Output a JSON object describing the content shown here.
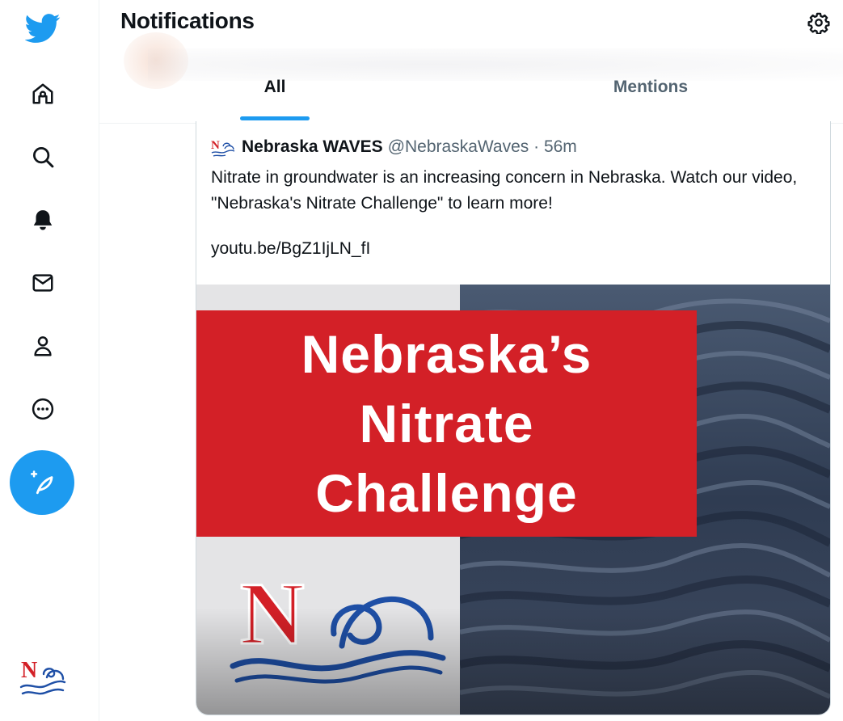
{
  "app": {
    "name": "Twitter"
  },
  "sidebar": {
    "items": [
      {
        "name": "home",
        "icon": "home-icon"
      },
      {
        "name": "explore",
        "icon": "search-icon"
      },
      {
        "name": "notifications",
        "icon": "bell-icon"
      },
      {
        "name": "messages",
        "icon": "mail-icon"
      },
      {
        "name": "profile",
        "icon": "person-icon"
      },
      {
        "name": "more",
        "icon": "more-circle-icon"
      }
    ],
    "compose_icon": "feather-plus-icon",
    "avatar_icon": "nebraska-waves-logo"
  },
  "header": {
    "title": "Notifications",
    "settings_icon": "gear-icon",
    "tabs": [
      {
        "label": "All",
        "active": true
      },
      {
        "label": "Mentions",
        "active": false
      }
    ]
  },
  "tweet": {
    "author_name": "Nebraska WAVES",
    "author_handle": "@NebraskaWaves · 56m",
    "text": "Nitrate in groundwater is an increasing concern in Nebraska. Watch our video, \"Nebraska's Nitrate Challenge\" to learn more!",
    "link": "youtu.be/BgZ1IjLN_fI",
    "media": {
      "banner_lines": [
        "Nebraska’s",
        "Nitrate",
        "Challenge"
      ],
      "logo_letter": "N"
    }
  },
  "colors": {
    "accent": "#1d9bf0",
    "text_primary": "#0f1419",
    "text_secondary": "#536471",
    "banner_red": "#d32027"
  }
}
